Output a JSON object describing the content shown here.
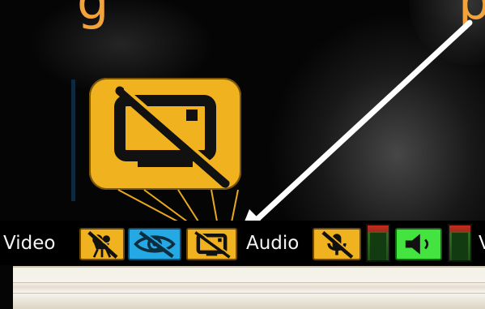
{
  "heading": {
    "left_fragment": "g",
    "right_fragment": "p"
  },
  "toolbar": {
    "video_label": "Video",
    "audio_label": "Audio",
    "cut_off_label": "V"
  },
  "icons": {
    "zoom": "screen-share-off-icon",
    "camera": "camera-off-icon",
    "eye": "eye-off-icon",
    "screen": "screen-share-off-icon",
    "mic": "microphone-off-icon",
    "speaker": "speaker-icon"
  },
  "colors": {
    "heading": "#f2a33a",
    "yellow": "#f1b21f",
    "cyan": "#25a9e4",
    "green": "#43e43f",
    "meter_red": "#c62b1c",
    "meter_green": "#2f6f20",
    "toolbar_text": "#f4f4f4"
  }
}
